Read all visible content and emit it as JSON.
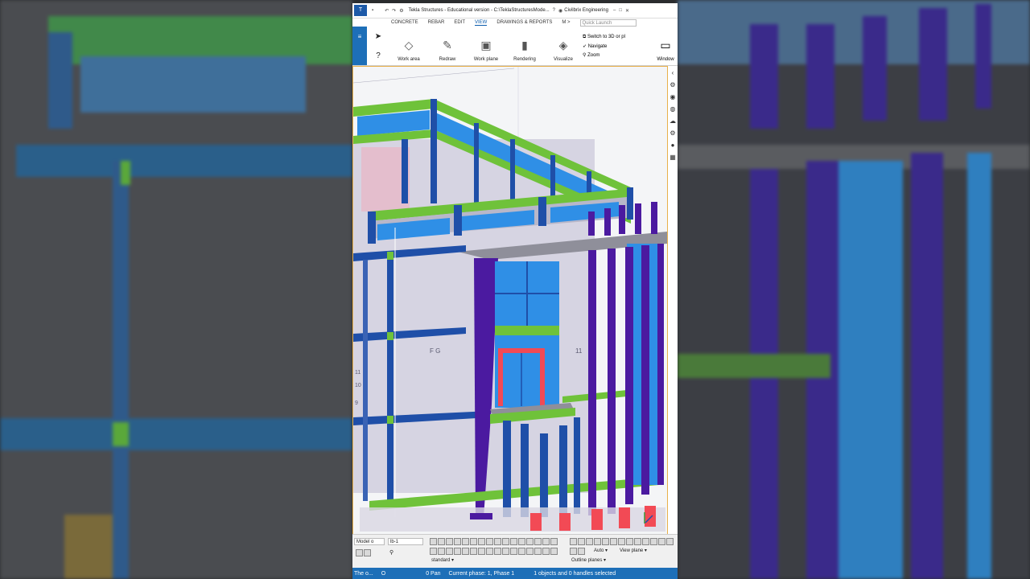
{
  "window": {
    "title": "Tekla Structures - Educational version - C:\\TeklaStructuresMode...",
    "org": "Civilbrix Engineering",
    "quick_launch_placeholder": "Quick Launch"
  },
  "menu": {
    "items": [
      "CONCRETE",
      "REBAR",
      "EDIT",
      "VIEW",
      "DRAWINGS & REPORTS",
      "M >"
    ],
    "active": "VIEW"
  },
  "ribbon": {
    "work_area": "Work area",
    "redraw": "Redraw",
    "work_plane": "Work plane",
    "rendering": "Rendering",
    "visualize": "Visualize",
    "switch_3d": "Switch to 3D or pl",
    "navigate": "Navigate",
    "zoom": "Zoom",
    "window": "Window"
  },
  "model_labels": {
    "left_fg": "F G",
    "left_11": "11",
    "left_10": "10",
    "left_9": "9",
    "right_11": "11"
  },
  "bottom": {
    "model_field": "Model o",
    "lb_field": "lb-1",
    "standard": "standard",
    "auto": "Auto",
    "view_plane": "View plane",
    "outline_planes": "Outline planes"
  },
  "status": {
    "left": "The o...",
    "o": "O",
    "pan": "0 Pan",
    "phase": "Current phase: 1, Phase 1",
    "selection": "1 objects and 0 handles selected"
  },
  "colors": {
    "accent_blue": "#1d6fb8",
    "beam_green": "#6fc23a",
    "column_blue": "#1f4fa8",
    "column_purple": "#4b1aa0",
    "glass_blue": "#2f8fe6",
    "door_red": "#f24a55",
    "viewport_border": "#e8b04a"
  }
}
